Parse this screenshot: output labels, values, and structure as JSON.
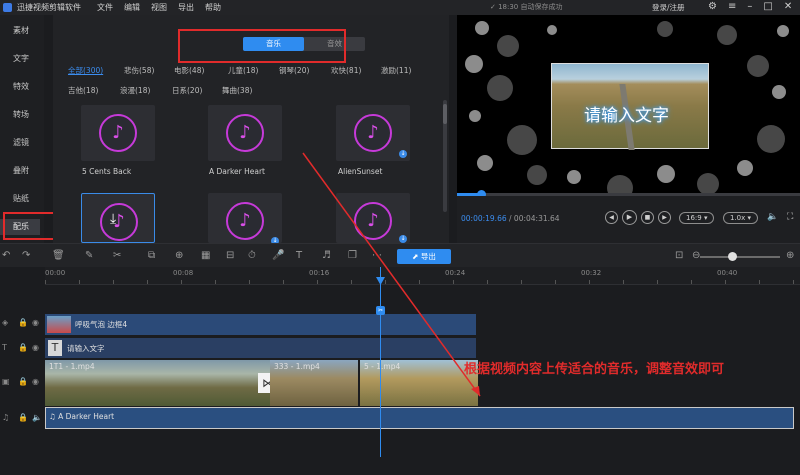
{
  "app": {
    "title": "迅捷视频剪辑软件",
    "menu": [
      "文件",
      "编辑",
      "视图",
      "导出",
      "帮助"
    ],
    "save_status": "✓ 18:30 自动保存成功",
    "login": "登录/注册"
  },
  "sidenav": {
    "items": [
      "素材",
      "文字",
      "特效",
      "转场",
      "滤镜",
      "叠附",
      "贴纸",
      "配乐"
    ],
    "active": "配乐"
  },
  "library": {
    "segments": [
      "音乐",
      "音效"
    ],
    "active_segment": "音乐",
    "categories": [
      "全部(300)",
      "悲伤(58)",
      "电影(48)",
      "儿童(18)",
      "钢琴(20)",
      "欢快(81)",
      "激励(11)",
      "吉他(18)",
      "浪漫(18)",
      "日系(20)",
      "舞曲(38)"
    ],
    "active_category": "全部(300)",
    "cards": [
      {
        "label": "5 Cents Back"
      },
      {
        "label": "A Darker Heart"
      },
      {
        "label": "AlienSunset"
      },
      {
        "label": ""
      },
      {
        "label": ""
      },
      {
        "label": ""
      }
    ]
  },
  "preview": {
    "overlay_text": "请输入文字",
    "current_time": "00:00:19.66",
    "total_time": "/ 00:04:31.64",
    "aspect": "16:9 ▾",
    "speed": "1.0x ▾",
    "progress": 0.07
  },
  "toolbar": {
    "export_label": "导出",
    "export_icon": "export-icon",
    "zoom_level": 0.4
  },
  "timeline": {
    "ruler_ticks": [
      "00:00",
      "00:08",
      "00:16",
      "00:24",
      "00:32",
      "00:40"
    ],
    "tracks": {
      "sticker_clip": "呼吸气泡 边框4",
      "text_clip": "请输入文字",
      "video_clips": [
        "1T1 - 1.mp4",
        "333 - 1.mp4",
        "5 - 1.mp4"
      ],
      "audio_clip": "A Darker Heart"
    }
  },
  "annotation": {
    "text": "根据视频内容上传适合的音乐，调整音效即可"
  },
  "colors": {
    "accent": "#2f8cf0",
    "highlight": "#e12b2b",
    "note": "#c63ad9"
  }
}
